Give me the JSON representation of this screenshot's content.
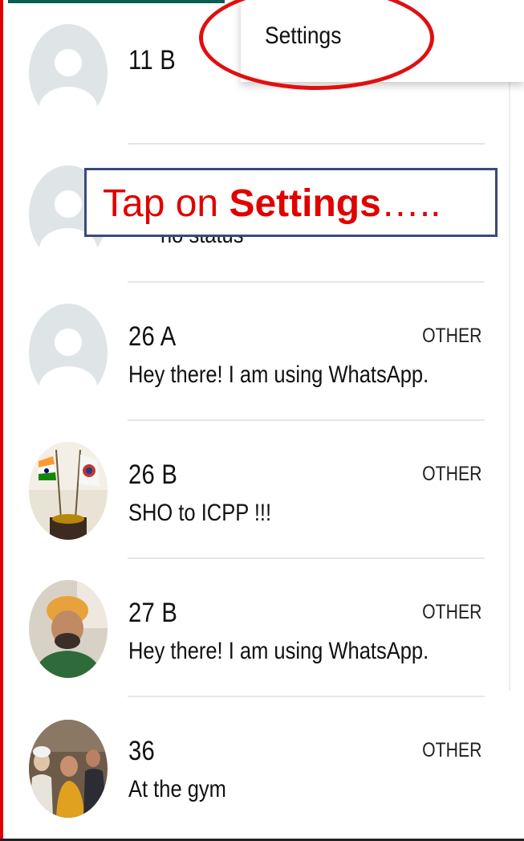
{
  "menu": {
    "settings_label": "Settings"
  },
  "callout": {
    "prefix": "Tap on ",
    "emphasis": "Settings",
    "suffix": "….."
  },
  "contacts": [
    {
      "name": "11 B",
      "status": "",
      "badge": "",
      "avatar": "placeholder-avatar"
    },
    {
      "name": "",
      "status": "no status",
      "badge": "",
      "avatar": "placeholder-avatar"
    },
    {
      "name": "26 A",
      "status": "Hey there! I am using WhatsApp.",
      "badge": "OTHER",
      "avatar": "placeholder-avatar"
    },
    {
      "name": "26 B",
      "status": "SHO to ICPP !!!",
      "badge": "OTHER",
      "avatar": "flags-photo-avatar"
    },
    {
      "name": "27 B",
      "status": "Hey there! I am using WhatsApp.",
      "badge": "OTHER",
      "avatar": "man-turban-photo-avatar"
    },
    {
      "name": "36",
      "status": "At the gym",
      "badge": "OTHER",
      "avatar": "group-photo-avatar"
    }
  ],
  "colors": {
    "accent_red": "#e00000",
    "callout_border": "#3c4a78",
    "app_green": "#075e54",
    "placeholder_gray": "#dfe5e7"
  }
}
